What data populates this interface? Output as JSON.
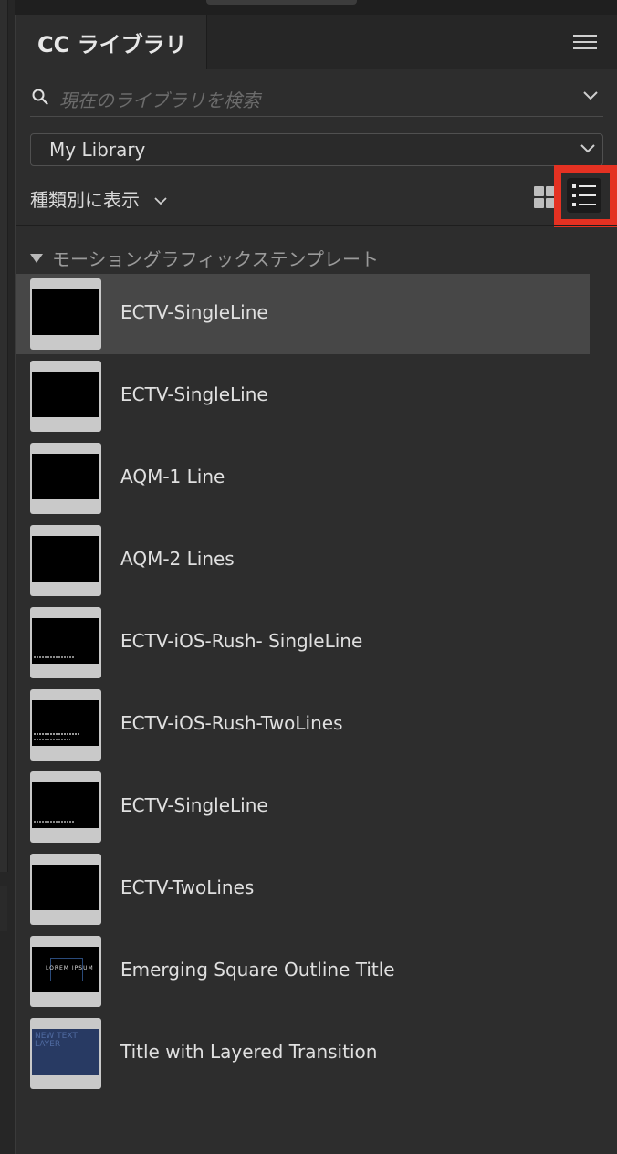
{
  "panel": {
    "tab_title": "CC ライブラリ",
    "search_placeholder": "現在のライブラリを検索",
    "library_selected": "My Library",
    "view_by_label": "種類別に表示",
    "section_title": "モーショングラフィックステンプレート"
  },
  "icons": {
    "menu": "hamburger-menu-icon",
    "search": "search-icon",
    "chevron": "chevron-down-icon",
    "grid_view": "grid-view-icon",
    "list_view": "list-view-icon",
    "disclosure": "disclosure-triangle-icon"
  },
  "colors": {
    "highlight_box": "#e43122",
    "selected_row": "#474747"
  },
  "items": [
    {
      "label": "ECTV-SingleLine",
      "thumb": "black",
      "selected": true
    },
    {
      "label": "ECTV-SingleLine",
      "thumb": "black",
      "selected": false
    },
    {
      "label": "AQM-1 Line",
      "thumb": "black",
      "selected": false
    },
    {
      "label": "AQM-2 Lines",
      "thumb": "black",
      "selected": false
    },
    {
      "label": "ECTV-iOS-Rush- SingleLine",
      "thumb": "lines",
      "selected": false
    },
    {
      "label": "ECTV-iOS-Rush-TwoLines",
      "thumb": "lines2",
      "selected": false
    },
    {
      "label": "ECTV-SingleLine",
      "thumb": "lines",
      "selected": false
    },
    {
      "label": "ECTV-TwoLines",
      "thumb": "black",
      "selected": false
    },
    {
      "label": "Emerging Square Outline Title",
      "thumb": "square",
      "thumb_text": "LOREM IPSUM",
      "selected": false
    },
    {
      "label": "Title with Layered Transition",
      "thumb": "blue",
      "thumb_text": "NEW TEXT LAYER",
      "selected": false
    }
  ]
}
